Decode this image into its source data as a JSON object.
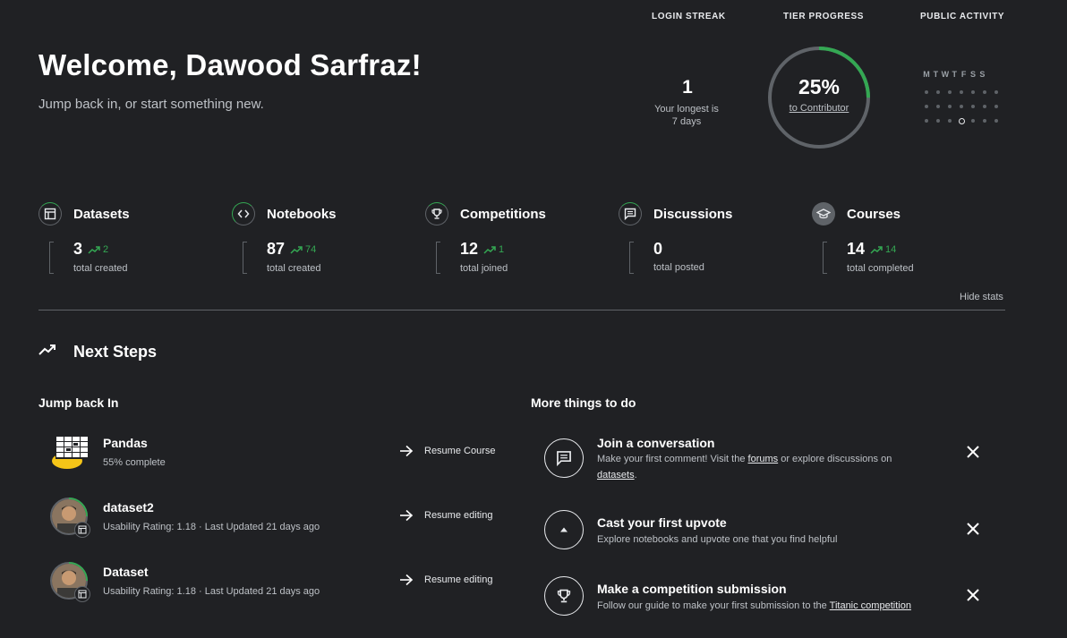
{
  "header": {
    "welcome": "Welcome, Dawood Sarfraz!",
    "subtitle": "Jump back in, or start something new."
  },
  "login_streak": {
    "label": "LOGIN STREAK",
    "value": "1",
    "longest_line1": "Your longest is",
    "longest_line2": "7 days"
  },
  "tier_progress": {
    "label": "TIER PROGRESS",
    "percent_text": "25%",
    "percent": 25,
    "target": "to Contributor"
  },
  "public_activity": {
    "label": "PUBLIC ACTIVITY",
    "days": [
      "M",
      "T",
      "W",
      "T",
      "F",
      "S",
      "S"
    ]
  },
  "stats": [
    {
      "title": "Datasets",
      "icon": "table-icon",
      "value": "3",
      "delta": "2",
      "sub": "total created"
    },
    {
      "title": "Notebooks",
      "icon": "code-icon",
      "value": "87",
      "delta": "74",
      "sub": "total created"
    },
    {
      "title": "Competitions",
      "icon": "trophy-icon",
      "value": "12",
      "delta": "1",
      "sub": "total joined"
    },
    {
      "title": "Discussions",
      "icon": "comment-icon",
      "value": "0",
      "delta": "",
      "sub": "total posted"
    },
    {
      "title": "Courses",
      "icon": "graduation-cap-icon",
      "value": "14",
      "delta": "14",
      "sub": "total completed"
    }
  ],
  "hide_stats": "Hide stats",
  "next_steps": {
    "title": "Next Steps",
    "jump_back_in": "Jump back In",
    "more_things": "More things to do",
    "items": [
      {
        "title": "Pandas",
        "sub": "55% complete",
        "action": "Resume Course"
      },
      {
        "title": "dataset2",
        "sub": "Usability Rating: 1.18 · Last Updated 21 days ago",
        "action": "Resume editing"
      },
      {
        "title": "Dataset",
        "sub": "Usability Rating: 1.18 · Last Updated 21 days ago",
        "action": "Resume editing"
      }
    ],
    "todos": [
      {
        "title": "Join a conversation",
        "icon": "comment-icon",
        "sub_1": "Make your first comment! Visit the ",
        "link_1": "forums",
        "sub_2": " or explore discussions on",
        "link_2": "datasets",
        "sub_3": "."
      },
      {
        "title": "Cast your first upvote",
        "icon": "upvote-icon",
        "sub": "Explore notebooks and upvote one that you find helpful"
      },
      {
        "title": "Make a competition submission",
        "icon": "trophy-icon",
        "sub_1": "Follow our guide to make your first submission to the ",
        "link_1": "Titanic competition"
      }
    ]
  },
  "colors": {
    "background": "#202124",
    "accent_green": "#34a853",
    "text": "#e8eaed",
    "muted": "#bdc1c6"
  }
}
